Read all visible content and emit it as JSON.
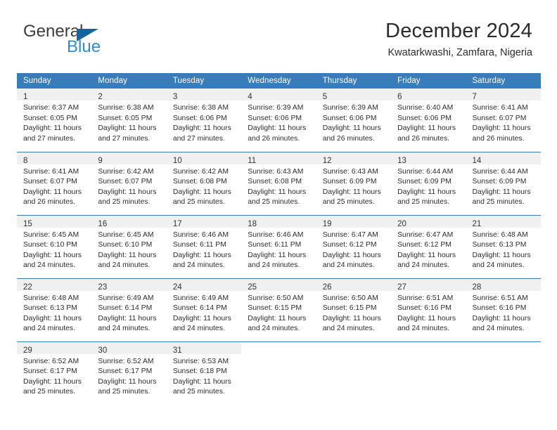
{
  "brand": {
    "name_top": "General",
    "name_bottom": "Blue",
    "accent_color": "#2e8bd0",
    "triangle_color": "#14659b"
  },
  "header": {
    "month_title": "December 2024",
    "location": "Kwatarkwashi, Zamfara, Nigeria"
  },
  "calendar": {
    "header_bg": "#3a7cba",
    "daynum_bg": "#f0f0f0",
    "weekdays": [
      "Sunday",
      "Monday",
      "Tuesday",
      "Wednesday",
      "Thursday",
      "Friday",
      "Saturday"
    ],
    "weeks": [
      [
        {
          "day": "1",
          "sunrise": "Sunrise: 6:37 AM",
          "sunset": "Sunset: 6:05 PM",
          "daylight1": "Daylight: 11 hours",
          "daylight2": "and 27 minutes."
        },
        {
          "day": "2",
          "sunrise": "Sunrise: 6:38 AM",
          "sunset": "Sunset: 6:05 PM",
          "daylight1": "Daylight: 11 hours",
          "daylight2": "and 27 minutes."
        },
        {
          "day": "3",
          "sunrise": "Sunrise: 6:38 AM",
          "sunset": "Sunset: 6:06 PM",
          "daylight1": "Daylight: 11 hours",
          "daylight2": "and 27 minutes."
        },
        {
          "day": "4",
          "sunrise": "Sunrise: 6:39 AM",
          "sunset": "Sunset: 6:06 PM",
          "daylight1": "Daylight: 11 hours",
          "daylight2": "and 26 minutes."
        },
        {
          "day": "5",
          "sunrise": "Sunrise: 6:39 AM",
          "sunset": "Sunset: 6:06 PM",
          "daylight1": "Daylight: 11 hours",
          "daylight2": "and 26 minutes."
        },
        {
          "day": "6",
          "sunrise": "Sunrise: 6:40 AM",
          "sunset": "Sunset: 6:06 PM",
          "daylight1": "Daylight: 11 hours",
          "daylight2": "and 26 minutes."
        },
        {
          "day": "7",
          "sunrise": "Sunrise: 6:41 AM",
          "sunset": "Sunset: 6:07 PM",
          "daylight1": "Daylight: 11 hours",
          "daylight2": "and 26 minutes."
        }
      ],
      [
        {
          "day": "8",
          "sunrise": "Sunrise: 6:41 AM",
          "sunset": "Sunset: 6:07 PM",
          "daylight1": "Daylight: 11 hours",
          "daylight2": "and 26 minutes."
        },
        {
          "day": "9",
          "sunrise": "Sunrise: 6:42 AM",
          "sunset": "Sunset: 6:07 PM",
          "daylight1": "Daylight: 11 hours",
          "daylight2": "and 25 minutes."
        },
        {
          "day": "10",
          "sunrise": "Sunrise: 6:42 AM",
          "sunset": "Sunset: 6:08 PM",
          "daylight1": "Daylight: 11 hours",
          "daylight2": "and 25 minutes."
        },
        {
          "day": "11",
          "sunrise": "Sunrise: 6:43 AM",
          "sunset": "Sunset: 6:08 PM",
          "daylight1": "Daylight: 11 hours",
          "daylight2": "and 25 minutes."
        },
        {
          "day": "12",
          "sunrise": "Sunrise: 6:43 AM",
          "sunset": "Sunset: 6:09 PM",
          "daylight1": "Daylight: 11 hours",
          "daylight2": "and 25 minutes."
        },
        {
          "day": "13",
          "sunrise": "Sunrise: 6:44 AM",
          "sunset": "Sunset: 6:09 PM",
          "daylight1": "Daylight: 11 hours",
          "daylight2": "and 25 minutes."
        },
        {
          "day": "14",
          "sunrise": "Sunrise: 6:44 AM",
          "sunset": "Sunset: 6:09 PM",
          "daylight1": "Daylight: 11 hours",
          "daylight2": "and 25 minutes."
        }
      ],
      [
        {
          "day": "15",
          "sunrise": "Sunrise: 6:45 AM",
          "sunset": "Sunset: 6:10 PM",
          "daylight1": "Daylight: 11 hours",
          "daylight2": "and 24 minutes."
        },
        {
          "day": "16",
          "sunrise": "Sunrise: 6:45 AM",
          "sunset": "Sunset: 6:10 PM",
          "daylight1": "Daylight: 11 hours",
          "daylight2": "and 24 minutes."
        },
        {
          "day": "17",
          "sunrise": "Sunrise: 6:46 AM",
          "sunset": "Sunset: 6:11 PM",
          "daylight1": "Daylight: 11 hours",
          "daylight2": "and 24 minutes."
        },
        {
          "day": "18",
          "sunrise": "Sunrise: 6:46 AM",
          "sunset": "Sunset: 6:11 PM",
          "daylight1": "Daylight: 11 hours",
          "daylight2": "and 24 minutes."
        },
        {
          "day": "19",
          "sunrise": "Sunrise: 6:47 AM",
          "sunset": "Sunset: 6:12 PM",
          "daylight1": "Daylight: 11 hours",
          "daylight2": "and 24 minutes."
        },
        {
          "day": "20",
          "sunrise": "Sunrise: 6:47 AM",
          "sunset": "Sunset: 6:12 PM",
          "daylight1": "Daylight: 11 hours",
          "daylight2": "and 24 minutes."
        },
        {
          "day": "21",
          "sunrise": "Sunrise: 6:48 AM",
          "sunset": "Sunset: 6:13 PM",
          "daylight1": "Daylight: 11 hours",
          "daylight2": "and 24 minutes."
        }
      ],
      [
        {
          "day": "22",
          "sunrise": "Sunrise: 6:48 AM",
          "sunset": "Sunset: 6:13 PM",
          "daylight1": "Daylight: 11 hours",
          "daylight2": "and 24 minutes."
        },
        {
          "day": "23",
          "sunrise": "Sunrise: 6:49 AM",
          "sunset": "Sunset: 6:14 PM",
          "daylight1": "Daylight: 11 hours",
          "daylight2": "and 24 minutes."
        },
        {
          "day": "24",
          "sunrise": "Sunrise: 6:49 AM",
          "sunset": "Sunset: 6:14 PM",
          "daylight1": "Daylight: 11 hours",
          "daylight2": "and 24 minutes."
        },
        {
          "day": "25",
          "sunrise": "Sunrise: 6:50 AM",
          "sunset": "Sunset: 6:15 PM",
          "daylight1": "Daylight: 11 hours",
          "daylight2": "and 24 minutes."
        },
        {
          "day": "26",
          "sunrise": "Sunrise: 6:50 AM",
          "sunset": "Sunset: 6:15 PM",
          "daylight1": "Daylight: 11 hours",
          "daylight2": "and 24 minutes."
        },
        {
          "day": "27",
          "sunrise": "Sunrise: 6:51 AM",
          "sunset": "Sunset: 6:16 PM",
          "daylight1": "Daylight: 11 hours",
          "daylight2": "and 24 minutes."
        },
        {
          "day": "28",
          "sunrise": "Sunrise: 6:51 AM",
          "sunset": "Sunset: 6:16 PM",
          "daylight1": "Daylight: 11 hours",
          "daylight2": "and 24 minutes."
        }
      ],
      [
        {
          "day": "29",
          "sunrise": "Sunrise: 6:52 AM",
          "sunset": "Sunset: 6:17 PM",
          "daylight1": "Daylight: 11 hours",
          "daylight2": "and 25 minutes."
        },
        {
          "day": "30",
          "sunrise": "Sunrise: 6:52 AM",
          "sunset": "Sunset: 6:17 PM",
          "daylight1": "Daylight: 11 hours",
          "daylight2": "and 25 minutes."
        },
        {
          "day": "31",
          "sunrise": "Sunrise: 6:53 AM",
          "sunset": "Sunset: 6:18 PM",
          "daylight1": "Daylight: 11 hours",
          "daylight2": "and 25 minutes."
        },
        {
          "day": "",
          "sunrise": "",
          "sunset": "",
          "daylight1": "",
          "daylight2": ""
        },
        {
          "day": "",
          "sunrise": "",
          "sunset": "",
          "daylight1": "",
          "daylight2": ""
        },
        {
          "day": "",
          "sunrise": "",
          "sunset": "",
          "daylight1": "",
          "daylight2": ""
        },
        {
          "day": "",
          "sunrise": "",
          "sunset": "",
          "daylight1": "",
          "daylight2": ""
        }
      ]
    ]
  }
}
